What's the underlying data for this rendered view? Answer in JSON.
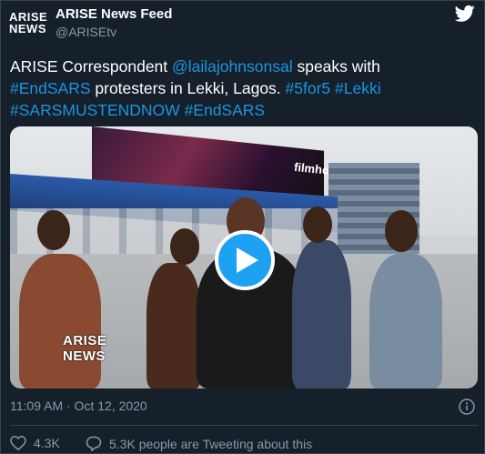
{
  "account": {
    "avatar_line1": "ARISE",
    "avatar_line2": "NEWS",
    "name": "ARISE News Feed",
    "handle": "@ARISEtv"
  },
  "tweet": {
    "part1": "ARISE Correspondent ",
    "mention": "@lailajohnsonsal",
    "part2": " speaks with ",
    "tag1": "#EndSARS",
    "part3": " protesters in Lekki, Lagos.  ",
    "tag2": "#5for5",
    "space1": " ",
    "tag3": "#Lekki",
    "tag4": "#SARSMUSTENDNOW",
    "space2": " ",
    "tag5": "#EndSARS"
  },
  "media": {
    "billboard_text": "filmhouse",
    "badge_line1": "ARISE",
    "badge_line2": "NEWS"
  },
  "meta": {
    "timestamp": "11:09 AM · Oct 12, 2020"
  },
  "actions": {
    "likes": "4.3K",
    "replies_text": "5.3K people are Tweeting about this"
  },
  "colors": {
    "background": "#15202b",
    "link": "#1b95e0",
    "secondary_text": "#8899a6",
    "twitter_blue": "#1da1f2"
  },
  "icons": {
    "logo": "twitter-bird-icon",
    "play": "play-icon",
    "info": "info-icon",
    "like": "heart-icon",
    "reply": "speech-bubble-icon"
  }
}
